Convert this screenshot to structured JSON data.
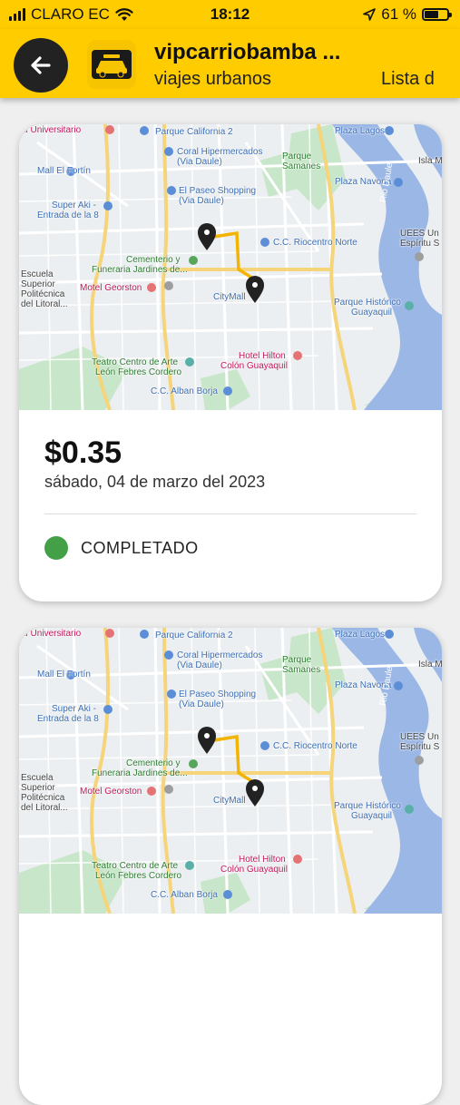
{
  "status_bar": {
    "carrier": "CLARO EC",
    "time": "18:12",
    "battery": "61 %",
    "battery_level": 0.61,
    "icons": [
      "signal-icon",
      "wifi-icon",
      "location-arrow-icon",
      "battery-icon"
    ]
  },
  "header": {
    "title": "vipcarriobamba ...",
    "subtitle": "viajes urbanos",
    "right_text": "Lista d",
    "back_icon": "arrow-left-icon",
    "logo_icon": "taxi-logo-icon",
    "colors": {
      "bar": "#ffcc00",
      "back_button": "#222222"
    }
  },
  "map": {
    "labels": {
      "univ": "al Universitario",
      "california": "Parque California 2",
      "pagos": "Plaza Lagos",
      "coral": "Coral Hipermercados",
      "coral2": "(Via Daule)",
      "samanes": "Parque",
      "samanes2": "Samanes",
      "isla": "Isla M",
      "fortin": "Mall El Fortín",
      "paseo": "El Paseo Shopping",
      "paseo2": "(Via Daule)",
      "navona": "Plaza Navona",
      "superaki": "Super Aki -",
      "superaki2": "Entrada de la 8",
      "rio": "Rio Daule",
      "uees": "UEES Un",
      "uees2": "Espíritu S",
      "cementerio": "Cementerio y",
      "cementerio2": "Funeraria Jardines de...",
      "riocentro": "C.C. Riocentro Norte",
      "escuela": "Escuela",
      "escuela2": "Superior",
      "escuela3": "Politécnica",
      "escuela4": "del Litoral...",
      "georston": "Motel Georston",
      "citymall": "CityMall",
      "historico": "Parque Histórico",
      "historico2": "Guayaquil",
      "hilton": "Hotel Hilton",
      "hilton2": "Colón Guayaquil",
      "teatro": "Teatro Centro de Arte",
      "teatro2": "León Febres Cordero",
      "alban": "C.C. Alban Borja"
    }
  },
  "trips": [
    {
      "amount": "$0.35",
      "date": "sábado, 04 de marzo del 2023",
      "status": "COMPLETADO",
      "status_color": "#43a047"
    },
    {
      "amount": "",
      "date": "",
      "status": "",
      "status_color": "#43a047"
    }
  ]
}
